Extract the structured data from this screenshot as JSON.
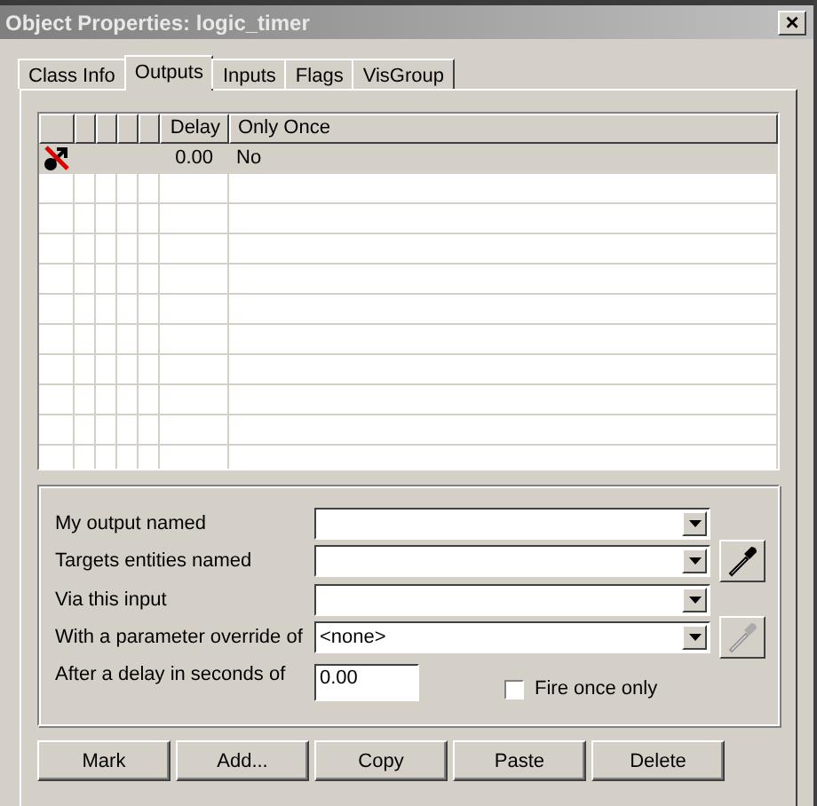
{
  "window": {
    "title": "Object Properties: logic_timer",
    "close": "×"
  },
  "tabs": [
    {
      "label": "Class Info",
      "selected": false
    },
    {
      "label": "Outputs",
      "selected": true
    },
    {
      "label": "Inputs",
      "selected": false
    },
    {
      "label": "Flags",
      "selected": false
    },
    {
      "label": "VisGroup",
      "selected": false
    }
  ],
  "outputs_list": {
    "columns": [
      "Delay",
      "Only Once"
    ],
    "rows": [
      {
        "selected": true,
        "delay": "0.00",
        "only_once": "No"
      }
    ]
  },
  "fields": [
    {
      "label": "My output named",
      "kind": "combo"
    },
    {
      "label": "Targets entities named",
      "kind": "combo",
      "picker": {
        "disabled": false
      }
    },
    {
      "label": "Via this input",
      "kind": "combo"
    },
    {
      "label": "With a parameter override of",
      "kind": "combo",
      "value": "<none>",
      "picker": {
        "disabled": true
      }
    },
    {
      "label": "After a delay in seconds of",
      "kind": "text",
      "value": "0.00",
      "checkbox": {
        "label": "Fire once only",
        "checked": false
      }
    }
  ],
  "buttons": [
    "Mark",
    "Add...",
    "Copy",
    "Paste",
    "Delete"
  ]
}
